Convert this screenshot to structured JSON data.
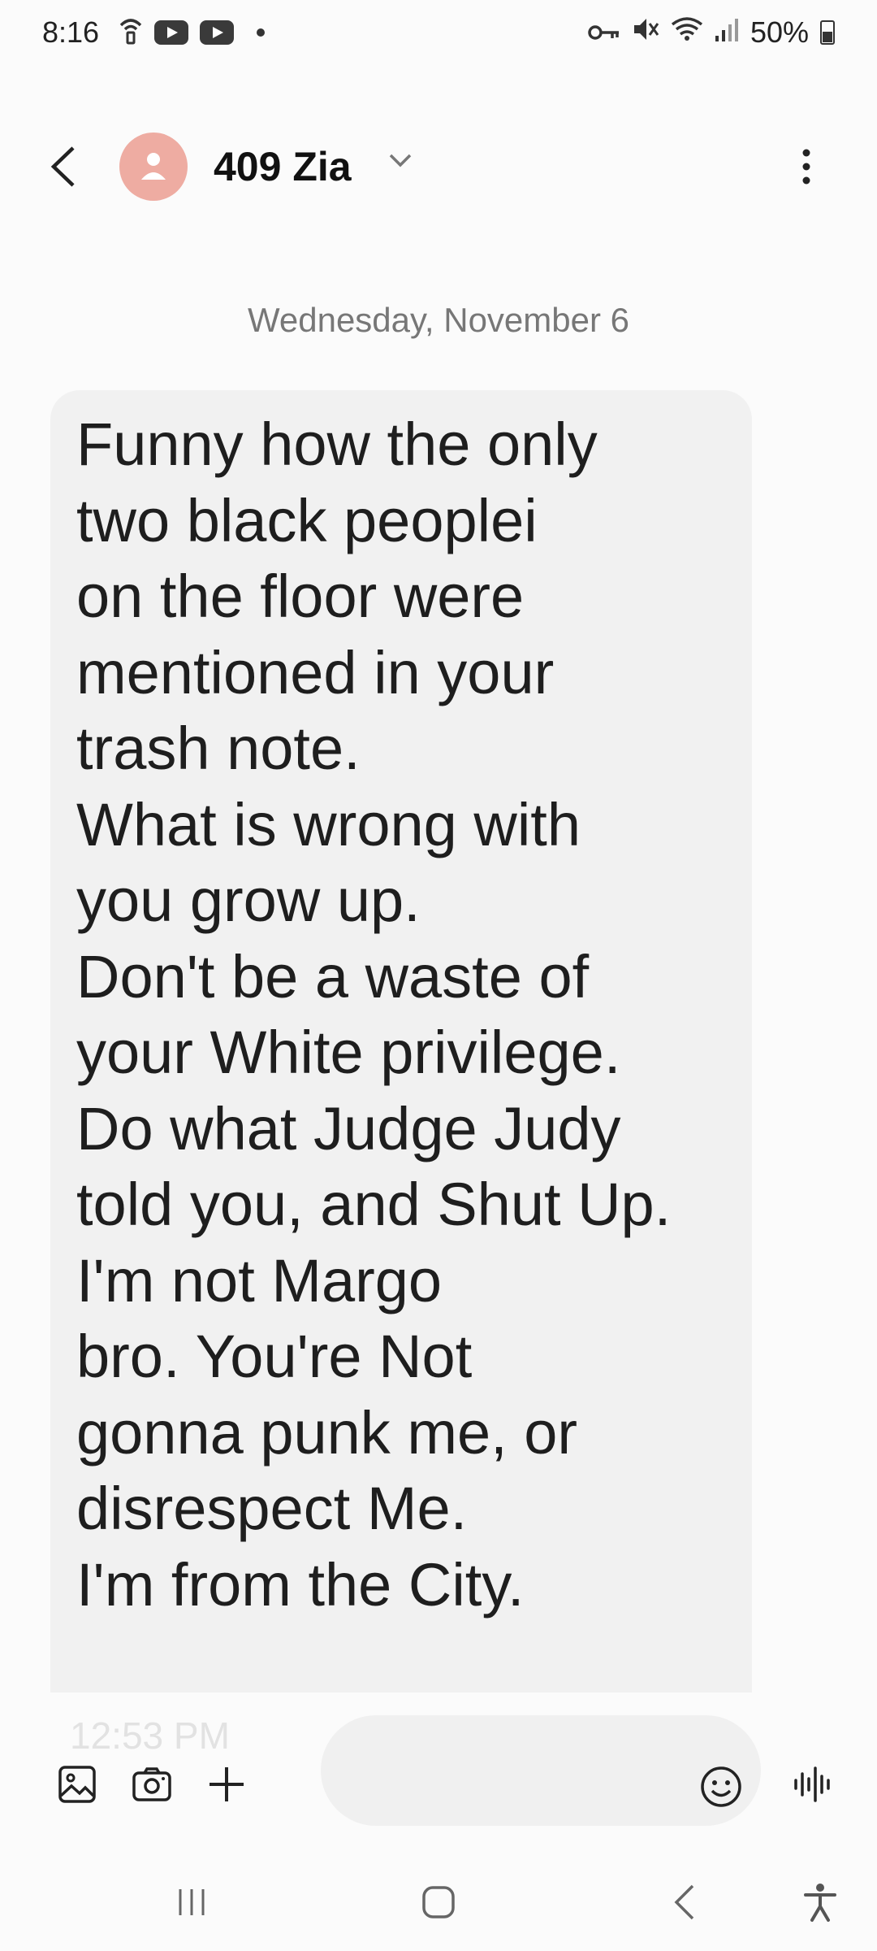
{
  "status_bar": {
    "time": "8:16",
    "battery": "50%"
  },
  "header": {
    "contact_name": "409 Zia"
  },
  "conversation": {
    "date_divider": "Wednesday, November 6",
    "message": "Funny how the only\ntwo black peoplei\non the floor were\nmentioned in your\ntrash note.\nWhat is wrong with\nyou grow up.\nDon't be a waste of\nyour White privilege.\nDo what Judge Judy\ntold you, and  Shut Up.\nI'm not Margo\nbro. You're Not\ngonna punk me, or\ndisrespect Me.\nI'm from the City.",
    "ghost_time": "12:53 PM"
  },
  "composer": {
    "placeholder": ""
  },
  "colors": {
    "avatar_bg": "#eeaca2",
    "bubble_bg": "#f1f1f1",
    "background": "#fbfbfb"
  },
  "icons": [
    "wifi-calling-icon",
    "youtube-icon",
    "key-icon",
    "mute-icon",
    "wifi-icon",
    "signal-icon",
    "battery-icon",
    "back-icon",
    "person-icon",
    "chevron-down-icon",
    "more-vert-icon",
    "gallery-icon",
    "camera-icon",
    "plus-icon",
    "emoji-icon",
    "voice-wave-icon",
    "recents-icon",
    "home-icon",
    "nav-back-icon",
    "accessibility-icon"
  ]
}
